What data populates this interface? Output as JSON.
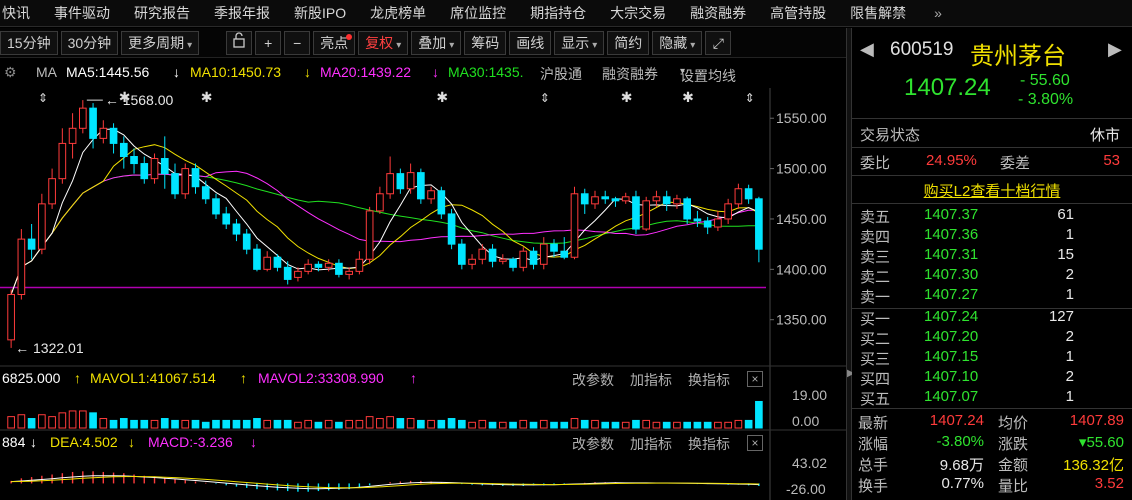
{
  "colors": {
    "up": "#ff3b3b",
    "down": "#00e5ff",
    "ma5": "#ffffff",
    "ma10": "#f0e000",
    "ma20": "#ff30ff",
    "ma30": "#20e020",
    "hline": "#b000b0"
  },
  "topnav": [
    "快讯",
    "事件驱动",
    "研究报告",
    "季报年报",
    "新股IPO",
    "龙虎榜单",
    "席位监控",
    "期指持仓",
    "大宗交易",
    "融资融券",
    "高管持股",
    "限售解禁"
  ],
  "topnav_more": "»",
  "toolbar": {
    "period1": "15分钟",
    "period2": "30分钟",
    "more_period": "更多周期",
    "highlight": "亮点",
    "adjust": "复权",
    "overlay": "叠加",
    "chips": "筹码",
    "draw": "画线",
    "display": "显示",
    "simple": "简约",
    "hide": "隐藏"
  },
  "legend": {
    "ma": "MA",
    "ma5": "MA5:1445.56",
    "ma10": "MA10:1450.73",
    "ma20": "MA20:1439.22",
    "ma30": "MA30:1435.",
    "hgt": "沪股通",
    "margin": "融资融券",
    "settings": "设置均线"
  },
  "price_axis": [
    "1550.00",
    "1500.00",
    "1450.00",
    "1400.00",
    "1350.00"
  ],
  "annotations": {
    "high": "1568.00",
    "low": "1322.01"
  },
  "vol_bar": {
    "value": "6825.000",
    "mavol1": "MAVOL1:41067.514",
    "mavol2": "MAVOL2:33308.990",
    "axis_hi": "19.00",
    "axis_lo": "0.00"
  },
  "macd_bar": {
    "dif": "884",
    "dea": "DEA:4.502",
    "macd": "MACD:-3.236",
    "axis_hi": "43.02",
    "axis_lo": "-26.00"
  },
  "panel_buttons": {
    "change_param": "改参数",
    "add_indicator": "加指标",
    "swap_indicator": "换指标",
    "close": "×"
  },
  "quote": {
    "code": "600519",
    "name": "贵州茅台",
    "price": "1407.24",
    "change": "- 55.60",
    "change_pct": "- 3.80%",
    "status_label": "交易状态",
    "status": "休市",
    "wb_label": "委比",
    "wb": "24.95%",
    "wc_label": "委差",
    "wc": "53",
    "l2_link": "购买L2查看十档行情",
    "asks": [
      {
        "label": "卖五",
        "price": "1407.37",
        "vol": "61"
      },
      {
        "label": "卖四",
        "price": "1407.36",
        "vol": "1"
      },
      {
        "label": "卖三",
        "price": "1407.31",
        "vol": "15"
      },
      {
        "label": "卖二",
        "price": "1407.30",
        "vol": "2"
      },
      {
        "label": "卖一",
        "price": "1407.27",
        "vol": "1"
      }
    ],
    "bids": [
      {
        "label": "买一",
        "price": "1407.24",
        "vol": "127"
      },
      {
        "label": "买二",
        "price": "1407.20",
        "vol": "2"
      },
      {
        "label": "买三",
        "price": "1407.15",
        "vol": "1"
      },
      {
        "label": "买四",
        "price": "1407.10",
        "vol": "2"
      },
      {
        "label": "买五",
        "price": "1407.07",
        "vol": "1"
      }
    ],
    "stats": [
      {
        "l1": "最新",
        "v1": "1407.24",
        "c1": "red",
        "l2": "均价",
        "v2": "1407.89",
        "c2": "red"
      },
      {
        "l1": "涨幅",
        "v1": "-3.80%",
        "c1": "green",
        "l2": "涨跌",
        "v2": "▾55.60",
        "c2": "green"
      },
      {
        "l1": "总手",
        "v1": "9.68万",
        "c1": "white",
        "l2": "金额",
        "v2": "136.32亿",
        "c2": "yellow"
      },
      {
        "l1": "换手",
        "v1": "0.77%",
        "c1": "white",
        "l2": "量比",
        "v2": "3.52",
        "c2": "red"
      }
    ]
  },
  "chart_data": {
    "type": "candlestick",
    "y_range": [
      1310,
      1580
    ],
    "candles": [
      [
        1330,
        1375,
        1322,
        1380
      ],
      [
        1375,
        1430,
        1370,
        1440
      ],
      [
        1430,
        1420,
        1410,
        1445
      ],
      [
        1420,
        1465,
        1415,
        1475
      ],
      [
        1465,
        1490,
        1460,
        1500
      ],
      [
        1490,
        1525,
        1485,
        1540
      ],
      [
        1525,
        1540,
        1510,
        1555
      ],
      [
        1540,
        1560,
        1535,
        1568
      ],
      [
        1560,
        1530,
        1520,
        1565
      ],
      [
        1530,
        1540,
        1525,
        1548
      ],
      [
        1540,
        1525,
        1515,
        1545
      ],
      [
        1525,
        1512,
        1500,
        1532
      ],
      [
        1512,
        1505,
        1495,
        1520
      ],
      [
        1505,
        1490,
        1485,
        1512
      ],
      [
        1490,
        1510,
        1485,
        1515
      ],
      [
        1510,
        1495,
        1480,
        1532
      ],
      [
        1495,
        1475,
        1470,
        1505
      ],
      [
        1475,
        1500,
        1470,
        1505
      ],
      [
        1500,
        1482,
        1475,
        1505
      ],
      [
        1482,
        1470,
        1465,
        1488
      ],
      [
        1470,
        1455,
        1450,
        1475
      ],
      [
        1455,
        1445,
        1440,
        1462
      ],
      [
        1445,
        1435,
        1428,
        1450
      ],
      [
        1435,
        1420,
        1415,
        1440
      ],
      [
        1420,
        1400,
        1398,
        1425
      ],
      [
        1400,
        1412,
        1398,
        1418
      ],
      [
        1412,
        1402,
        1398,
        1415
      ],
      [
        1402,
        1390,
        1385,
        1408
      ],
      [
        1392,
        1398,
        1388,
        1402
      ],
      [
        1398,
        1405,
        1395,
        1410
      ],
      [
        1405,
        1402,
        1398,
        1408
      ],
      [
        1402,
        1406,
        1398,
        1410
      ],
      [
        1406,
        1395,
        1392,
        1410
      ],
      [
        1395,
        1398,
        1390,
        1402
      ],
      [
        1398,
        1410,
        1395,
        1418
      ],
      [
        1410,
        1458,
        1405,
        1462
      ],
      [
        1458,
        1475,
        1455,
        1482
      ],
      [
        1475,
        1495,
        1470,
        1512
      ],
      [
        1495,
        1480,
        1475,
        1500
      ],
      [
        1480,
        1496,
        1475,
        1505
      ],
      [
        1496,
        1470,
        1465,
        1500
      ],
      [
        1470,
        1478,
        1465,
        1482
      ],
      [
        1478,
        1455,
        1450,
        1482
      ],
      [
        1455,
        1425,
        1420,
        1460
      ],
      [
        1425,
        1405,
        1400,
        1430
      ],
      [
        1405,
        1410,
        1400,
        1415
      ],
      [
        1410,
        1420,
        1405,
        1425
      ],
      [
        1420,
        1408,
        1402,
        1425
      ],
      [
        1408,
        1410,
        1405,
        1415
      ],
      [
        1410,
        1402,
        1398,
        1412
      ],
      [
        1402,
        1418,
        1398,
        1422
      ],
      [
        1418,
        1405,
        1400,
        1422
      ],
      [
        1405,
        1425,
        1400,
        1432
      ],
      [
        1425,
        1418,
        1412,
        1430
      ],
      [
        1418,
        1412,
        1410,
        1432
      ],
      [
        1412,
        1475,
        1410,
        1482
      ],
      [
        1475,
        1465,
        1455,
        1480
      ],
      [
        1465,
        1472,
        1460,
        1478
      ],
      [
        1472,
        1470,
        1465,
        1478
      ],
      [
        1470,
        1468,
        1462,
        1472
      ],
      [
        1468,
        1472,
        1465,
        1476
      ],
      [
        1472,
        1440,
        1435,
        1478
      ],
      [
        1440,
        1468,
        1438,
        1472
      ],
      [
        1468,
        1472,
        1462,
        1478
      ],
      [
        1472,
        1465,
        1458,
        1478
      ],
      [
        1465,
        1470,
        1460,
        1474
      ],
      [
        1470,
        1450,
        1445,
        1472
      ],
      [
        1450,
        1448,
        1442,
        1458
      ],
      [
        1448,
        1442,
        1435,
        1452
      ],
      [
        1442,
        1450,
        1438,
        1458
      ],
      [
        1450,
        1465,
        1445,
        1470
      ],
      [
        1465,
        1480,
        1460,
        1485
      ],
      [
        1480,
        1470,
        1465,
        1484
      ],
      [
        1470,
        1420,
        1407,
        1472
      ]
    ],
    "hline": 1382,
    "volume": [
      6,
      7,
      5,
      7,
      6,
      8,
      9,
      9,
      8,
      5,
      4,
      5,
      4,
      4,
      4,
      5,
      4,
      4,
      4,
      3,
      4,
      4,
      4,
      4,
      5,
      4,
      4,
      4,
      3,
      4,
      3,
      4,
      3,
      4,
      4,
      6,
      5,
      6,
      5,
      5,
      4,
      4,
      4,
      5,
      4,
      3,
      4,
      3,
      3,
      3,
      4,
      3,
      4,
      3,
      3,
      5,
      4,
      4,
      3,
      3,
      3,
      4,
      4,
      3,
      3,
      3,
      3,
      3,
      3,
      3,
      3,
      4,
      4,
      14
    ],
    "vol_range": [
      0,
      19
    ],
    "macd": [
      4,
      8,
      10,
      12,
      14,
      16,
      18,
      19,
      19,
      18,
      17,
      16,
      14,
      12,
      11,
      9,
      7,
      5,
      3,
      1,
      -1,
      -3,
      -5,
      -7,
      -9,
      -10,
      -11,
      -12,
      -13,
      -13,
      -12,
      -11,
      -10,
      -9,
      -6,
      -3,
      0,
      2,
      3,
      4,
      4,
      3,
      2,
      1,
      -1,
      -2,
      -3,
      -3,
      -4,
      -4,
      -4,
      -3,
      -3,
      -2,
      -1,
      0,
      1,
      2,
      2,
      2,
      1,
      1,
      1,
      1,
      1,
      0,
      0,
      -1,
      -1,
      -1,
      -2,
      -2,
      -3,
      -4
    ],
    "macd_range": [
      -26,
      43
    ]
  }
}
